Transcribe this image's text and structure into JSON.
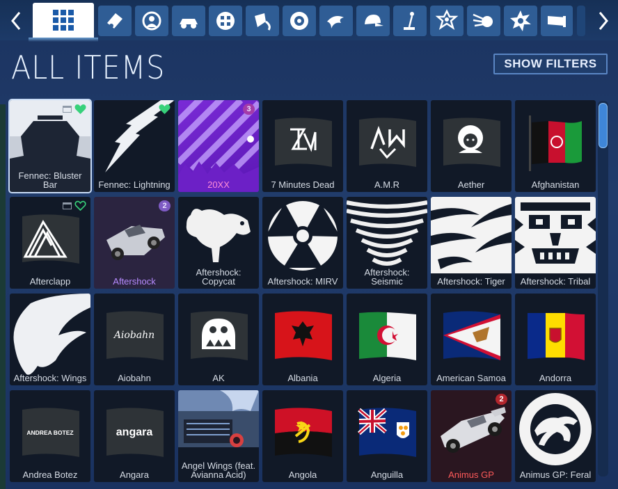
{
  "header": {
    "title": "ALL ITEMS",
    "show_filters_label": "SHOW FILTERS",
    "tabs": [
      {
        "icon": "all-items-grid-icon",
        "active": true
      },
      {
        "icon": "decal-icon"
      },
      {
        "icon": "avatar-border-icon"
      },
      {
        "icon": "car-body-icon"
      },
      {
        "icon": "wheels-icon"
      },
      {
        "icon": "paint-finish-icon"
      },
      {
        "icon": "goal-explosion-icon"
      },
      {
        "icon": "rocket-boost-icon"
      },
      {
        "icon": "topper-cap-icon"
      },
      {
        "icon": "antenna-icon"
      },
      {
        "icon": "banner-icon"
      },
      {
        "icon": "trail-icon"
      },
      {
        "icon": "engine-audio-icon"
      },
      {
        "icon": "player-banner-icon"
      }
    ]
  },
  "items": [
    {
      "name": "Fennec: Bluster Bar",
      "selected": true,
      "favorite": true,
      "tradeable": true
    },
    {
      "name": "Fennec: Lightning",
      "favorite": true
    },
    {
      "name": "20XX",
      "count": "3"
    },
    {
      "name": "7 Minutes Dead"
    },
    {
      "name": "A.M.R"
    },
    {
      "name": "Aether"
    },
    {
      "name": "Afghanistan"
    },
    {
      "name": "Afterclapp",
      "favorite": true,
      "tradeable": true
    },
    {
      "name": "Aftershock",
      "count": "2"
    },
    {
      "name": "Aftershock: Copycat"
    },
    {
      "name": "Aftershock: MIRV"
    },
    {
      "name": "Aftershock: Seismic"
    },
    {
      "name": "Aftershock: Tiger"
    },
    {
      "name": "Aftershock: Tribal"
    },
    {
      "name": "Aftershock: Wings"
    },
    {
      "name": "Aiobahn"
    },
    {
      "name": "AK"
    },
    {
      "name": "Albania"
    },
    {
      "name": "Algeria"
    },
    {
      "name": "American Samoa"
    },
    {
      "name": "Andorra"
    },
    {
      "name": "Andrea Botez"
    },
    {
      "name": "Angara"
    },
    {
      "name": "Angel Wings (feat. Avianna Acid)"
    },
    {
      "name": "Angola"
    },
    {
      "name": "Anguilla"
    },
    {
      "name": "Animus GP",
      "count": "2"
    },
    {
      "name": "Animus GP: Feral"
    }
  ],
  "flag_text": {
    "aiobahn": "Aiobahn",
    "andrea": "ANDREA BOTEZ",
    "angara": "angara"
  },
  "colors": {
    "background": "#1d3766",
    "tab": "#2f5d95",
    "active_tab": "#ffffff",
    "favorite": "#37d17a",
    "rare_purple": "#b78bff",
    "exotic_red": "#ff5a5a"
  }
}
